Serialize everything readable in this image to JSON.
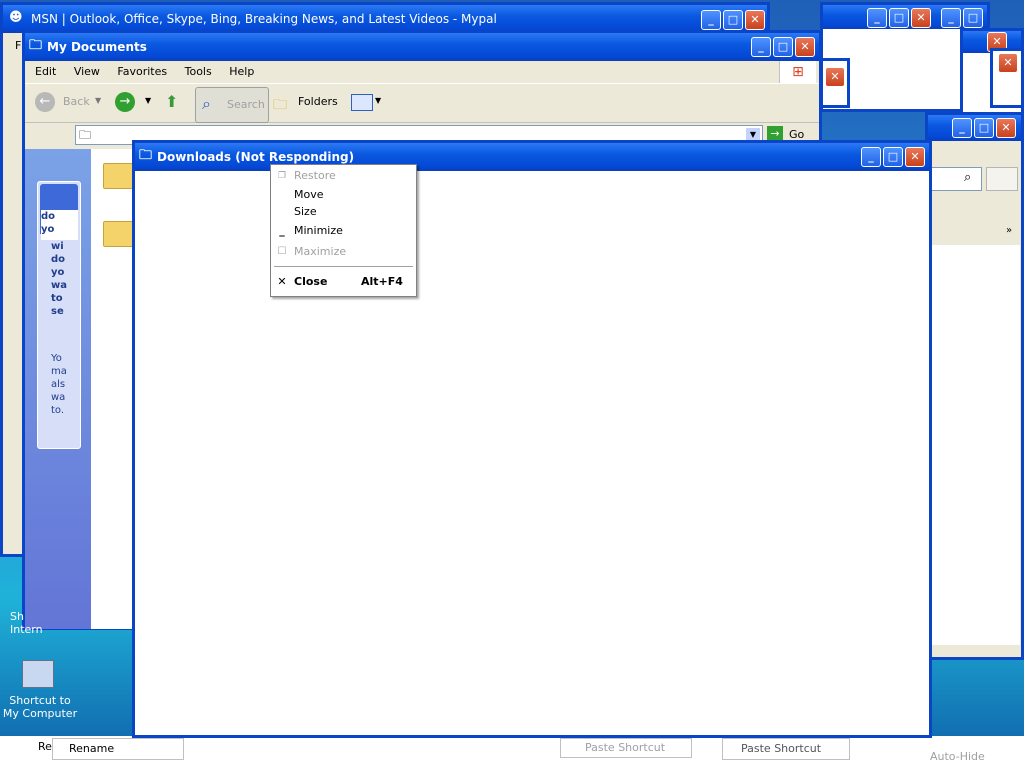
{
  "msn_window": {
    "title": "MSN | Outlook, Office, Skype, Bing, Breaking News, and Latest Videos - Mypal",
    "menu_first_letter": "F"
  },
  "my_documents": {
    "title": "My Documents",
    "menu": [
      "Edit",
      "View",
      "Favorites",
      "Tools",
      "Help"
    ],
    "toolbar": {
      "back": "Back",
      "search": "Search",
      "folders": "Folders"
    },
    "address": {
      "value": "",
      "go": "Go"
    },
    "task_panel": {
      "line1": [
        "do",
        "yo"
      ],
      "line2": [
        "wi",
        "do",
        "yo",
        "wa",
        "to",
        "se"
      ],
      "line3": [
        "Yo",
        "ma",
        "als",
        "wa",
        "to."
      ]
    }
  },
  "downloads_window": {
    "title": "Downloads (Not Responding)"
  },
  "context_menu": {
    "items": [
      {
        "label": "Restore",
        "enabled": false,
        "icon": "restore-icon"
      },
      {
        "label": "Move",
        "enabled": true
      },
      {
        "label": "Size",
        "enabled": true
      },
      {
        "label": "Minimize",
        "enabled": true,
        "icon": "minimize-icon"
      },
      {
        "label": "Maximize",
        "enabled": false,
        "icon": "maximize-icon"
      },
      {
        "label": "Close",
        "enabled": true,
        "icon": "close-icon",
        "shortcut": "Alt+F4",
        "bold": true
      }
    ]
  },
  "desktop": {
    "shortcut_internet_1": "Sh",
    "shortcut_internet_2": "Intern",
    "shortcut_my_computer": "Shortcut to My Computer",
    "left_frag": "Re"
  },
  "bottom_fragments": {
    "rename": "Rename",
    "paste_shortcut_1": "Paste Shortcut",
    "paste_shortcut_2": "Paste Shortcut",
    "auto_hide": "Auto-Hide"
  }
}
